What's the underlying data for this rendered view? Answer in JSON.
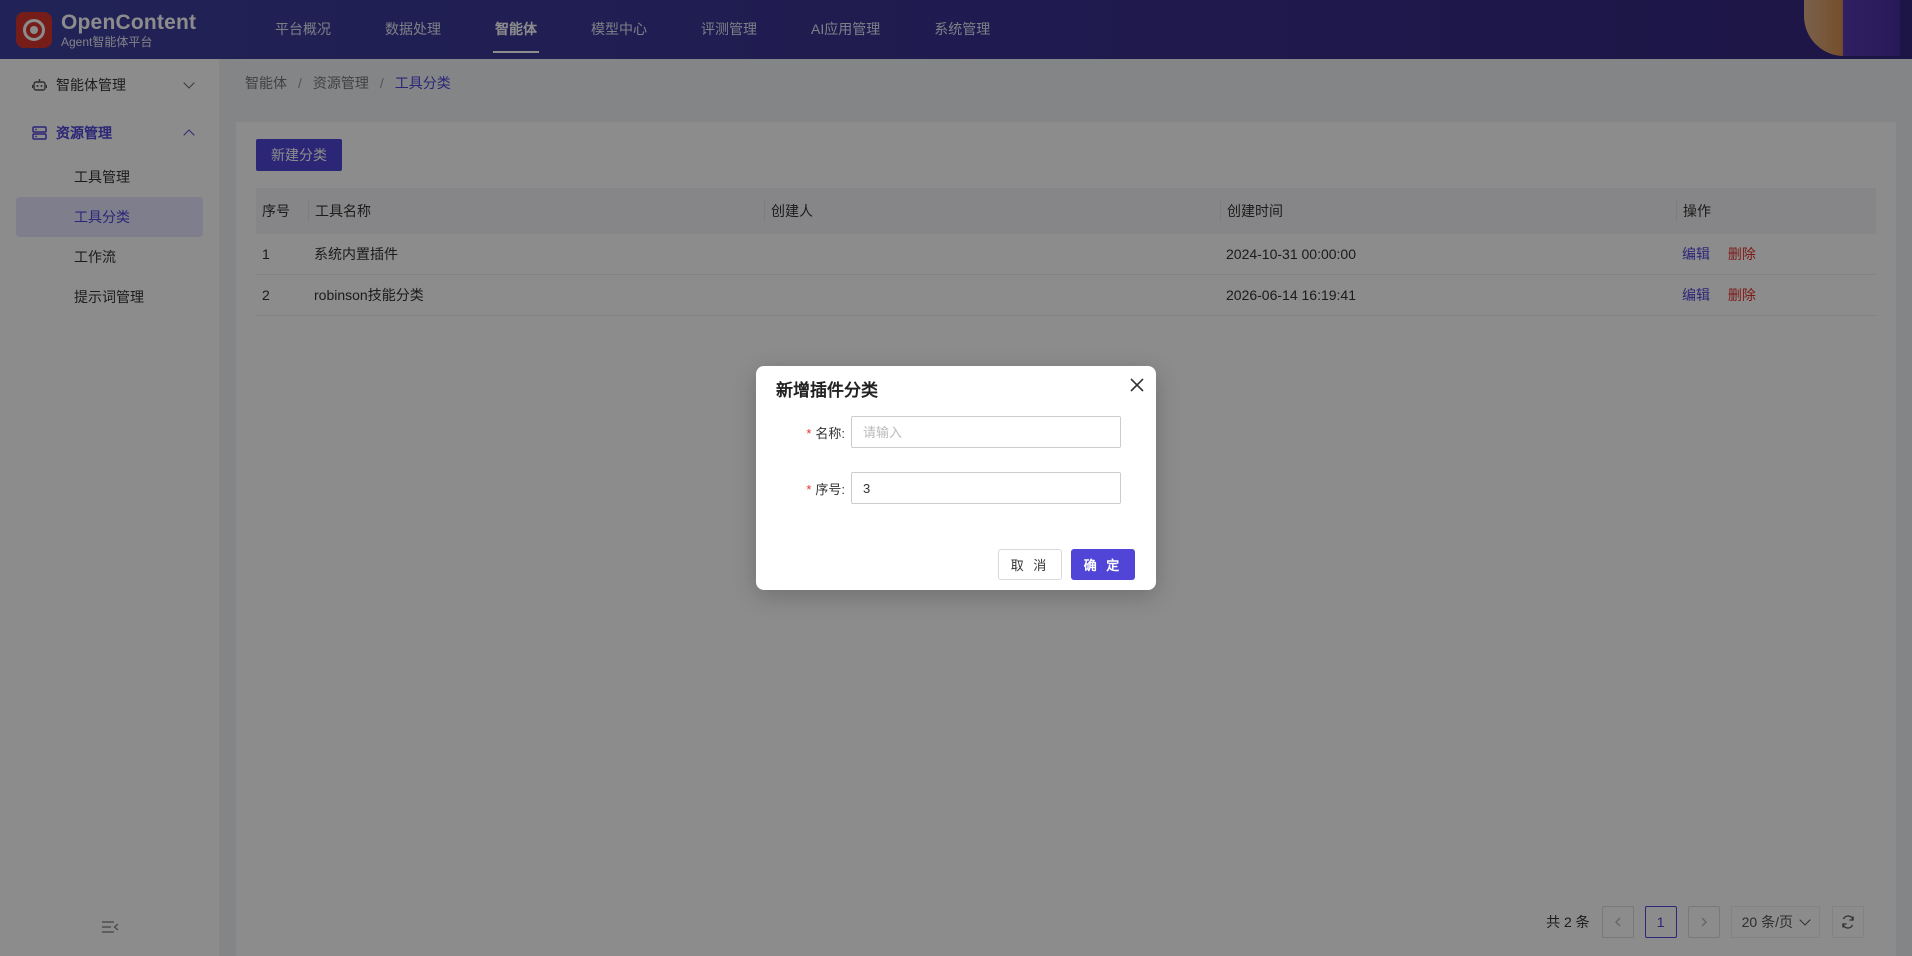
{
  "header": {
    "logo_title": "OpenContent",
    "logo_subtitle": "Agent智能体平台",
    "nav": [
      {
        "label": "平台概况"
      },
      {
        "label": "数据处理"
      },
      {
        "label": "智能体",
        "active": true
      },
      {
        "label": "模型中心"
      },
      {
        "label": "评测管理"
      },
      {
        "label": "AI应用管理"
      },
      {
        "label": "系统管理"
      }
    ]
  },
  "sidebar": {
    "groups": [
      {
        "label": "智能体管理",
        "icon": "robot-icon",
        "expanded": false
      },
      {
        "label": "资源管理",
        "icon": "server-icon",
        "expanded": true
      }
    ],
    "sub_items": [
      {
        "label": "工具管理"
      },
      {
        "label": "工具分类",
        "active": true
      },
      {
        "label": "工作流"
      },
      {
        "label": "提示词管理"
      }
    ]
  },
  "breadcrumb": [
    "智能体",
    "资源管理",
    "工具分类"
  ],
  "toolbar": {
    "new_label": "新建分类"
  },
  "table": {
    "columns": [
      "序号",
      "工具名称",
      "创建人",
      "创建时间",
      "操作"
    ],
    "rows": [
      {
        "index": "1",
        "name": "系统内置插件",
        "creator": "",
        "created": "2024-10-31 00:00:00",
        "edit": "编辑",
        "delete": "删除"
      },
      {
        "index": "2",
        "name": "robinson技能分类",
        "creator": "",
        "created": "2026-06-14 16:19:41",
        "edit": "编辑",
        "delete": "删除"
      }
    ]
  },
  "pagination": {
    "total": "共 2 条",
    "current_page": "1",
    "page_size": "20 条/页"
  },
  "dialog": {
    "title": "新增插件分类",
    "fields": [
      {
        "label": "名称:",
        "required": "*",
        "value": "",
        "placeholder": "请输入"
      },
      {
        "label": "序号:",
        "required": "*",
        "value": "3",
        "placeholder": ""
      }
    ],
    "cancel_label": "取 消",
    "ok_label": "确 定"
  },
  "colors": {
    "primary": "#5145d8",
    "danger": "#e5312a",
    "header_bg": "#3a2f8f"
  }
}
